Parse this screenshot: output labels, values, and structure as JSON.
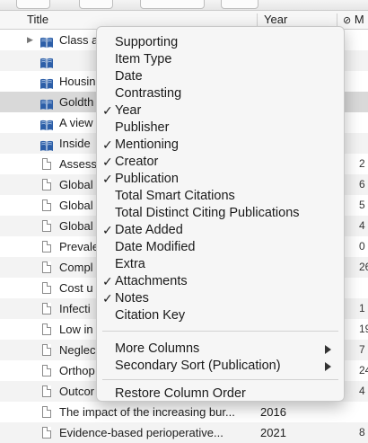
{
  "header": {
    "title_col": "Title",
    "year_col": "Year",
    "third_col": "M"
  },
  "rows": [
    {
      "title": "Class a",
      "year": "",
      "extra": "",
      "icon": "folder-book",
      "twisty": true
    },
    {
      "title": "",
      "year": "",
      "extra": "",
      "icon": "book"
    },
    {
      "title": "Housin",
      "year": "",
      "extra": "",
      "icon": "book"
    },
    {
      "title": "Goldth",
      "year": "",
      "extra": "",
      "icon": "book",
      "selected": true
    },
    {
      "title": "A view",
      "year": "",
      "extra": "",
      "icon": "book"
    },
    {
      "title": "Inside",
      "year": "",
      "extra": "",
      "icon": "book"
    },
    {
      "title": "Assess",
      "year": "",
      "extra": "2",
      "icon": "doc"
    },
    {
      "title": "Global",
      "year": "",
      "extra": "6",
      "icon": "doc"
    },
    {
      "title": "Global",
      "year": "",
      "extra": "5",
      "icon": "doc"
    },
    {
      "title": "Global",
      "year": "",
      "extra": "4",
      "icon": "doc"
    },
    {
      "title": "Prevale",
      "year": "",
      "extra": "0",
      "icon": "doc"
    },
    {
      "title": "Compl",
      "year": "",
      "extra": "26",
      "icon": "doc"
    },
    {
      "title": "Cost u",
      "year": "",
      "extra": "",
      "icon": "doc"
    },
    {
      "title": "Infecti",
      "year": "",
      "extra": "1",
      "icon": "doc"
    },
    {
      "title": "Low in",
      "year": "",
      "extra": "19",
      "icon": "doc"
    },
    {
      "title": "Neglec",
      "year": "",
      "extra": "7",
      "icon": "doc"
    },
    {
      "title": "Orthop",
      "year": "",
      "extra": "24",
      "icon": "doc"
    },
    {
      "title": "Outcor",
      "year": "",
      "extra": "4",
      "icon": "doc"
    },
    {
      "title": "The impact of the increasing bur...",
      "year": "2016",
      "extra": "",
      "icon": "doc"
    },
    {
      "title": "Evidence-based perioperative...",
      "year": "2021",
      "extra": "8",
      "icon": "doc"
    }
  ],
  "menu": {
    "items": [
      {
        "label": "Supporting",
        "checked": false
      },
      {
        "label": "Item Type",
        "checked": false
      },
      {
        "label": "Date",
        "checked": false
      },
      {
        "label": "Contrasting",
        "checked": false
      },
      {
        "label": "Year",
        "checked": true
      },
      {
        "label": "Publisher",
        "checked": false
      },
      {
        "label": "Mentioning",
        "checked": true
      },
      {
        "label": "Creator",
        "checked": true
      },
      {
        "label": "Publication",
        "checked": true
      },
      {
        "label": "Total Smart Citations",
        "checked": false
      },
      {
        "label": "Total Distinct Citing Publications",
        "checked": false
      },
      {
        "label": "Date Added",
        "checked": true
      },
      {
        "label": "Date Modified",
        "checked": false
      },
      {
        "label": "Extra",
        "checked": false
      },
      {
        "label": "Attachments",
        "checked": true
      },
      {
        "label": "Notes",
        "checked": true
      },
      {
        "label": "Citation Key",
        "checked": false
      }
    ],
    "submenus": [
      {
        "label": "More Columns"
      },
      {
        "label": "Secondary Sort (Publication)"
      }
    ],
    "restore_label": "Restore Column Order",
    "check_glyph": "✓"
  },
  "colors": {
    "selected_row": "#d9d9d9",
    "book_icon": "#2d5fa8"
  }
}
